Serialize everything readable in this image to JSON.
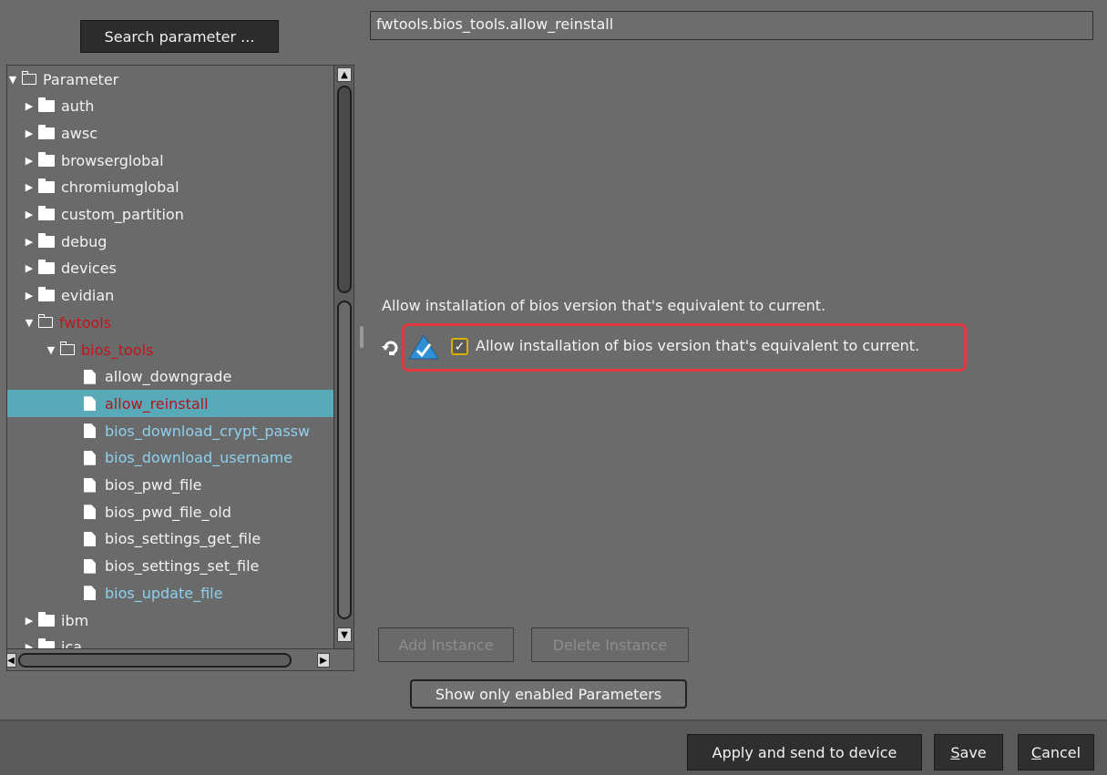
{
  "search": {
    "button_label": "Search parameter ..."
  },
  "tree": {
    "items": [
      {
        "label": "Parameter",
        "expanded": true,
        "kind": "folder-open",
        "state": "normal"
      },
      {
        "label": "auth",
        "kind": "folder",
        "state": "normal"
      },
      {
        "label": "awsc",
        "kind": "folder",
        "state": "normal"
      },
      {
        "label": "browserglobal",
        "kind": "folder",
        "state": "normal"
      },
      {
        "label": "chromiumglobal",
        "kind": "folder",
        "state": "normal"
      },
      {
        "label": "custom_partition",
        "kind": "folder",
        "state": "normal"
      },
      {
        "label": "debug",
        "kind": "folder",
        "state": "normal"
      },
      {
        "label": "devices",
        "kind": "folder",
        "state": "normal"
      },
      {
        "label": "evidian",
        "kind": "folder",
        "state": "normal"
      },
      {
        "label": "fwtools",
        "kind": "folder-open",
        "state": "modified"
      },
      {
        "label": "bios_tools",
        "kind": "folder-open",
        "state": "modified"
      },
      {
        "label": "allow_downgrade",
        "kind": "file",
        "state": "normal"
      },
      {
        "label": "allow_reinstall",
        "kind": "file",
        "state": "selected"
      },
      {
        "label": "bios_download_crypt_passw",
        "kind": "file",
        "state": "special"
      },
      {
        "label": "bios_download_username",
        "kind": "file",
        "state": "special"
      },
      {
        "label": "bios_pwd_file",
        "kind": "file",
        "state": "normal"
      },
      {
        "label": "bios_pwd_file_old",
        "kind": "file",
        "state": "normal"
      },
      {
        "label": "bios_settings_get_file",
        "kind": "file",
        "state": "normal"
      },
      {
        "label": "bios_settings_set_file",
        "kind": "file",
        "state": "normal"
      },
      {
        "label": "bios_update_file",
        "kind": "file",
        "state": "special"
      },
      {
        "label": "ibm",
        "kind": "folder",
        "state": "normal"
      },
      {
        "label": "ica",
        "kind": "folder",
        "state": "normal"
      }
    ]
  },
  "detail": {
    "path": "fwtools.bios_tools.allow_reinstall",
    "description": "Allow installation of bios version that's equivalent to current.",
    "checkbox_label": "Allow installation of bios version that's equivalent to current.",
    "checkbox_checked": true,
    "add_instance_label": "Add Instance",
    "delete_instance_label": "Delete Instance",
    "show_enabled_label": "Show only enabled Parameters"
  },
  "footer": {
    "apply_label": "Apply and send to device",
    "save_mnemonic": "S",
    "save_rest": "ave",
    "cancel_mnemonic": "C",
    "cancel_rest": "ancel"
  },
  "colors": {
    "background": "#6b6b6b",
    "selection": "#58aab9",
    "modified_text": "#c2141c",
    "special_text": "#8fd0ee",
    "highlight_border": "#e33a42",
    "checkbox_border": "#d8b000"
  }
}
